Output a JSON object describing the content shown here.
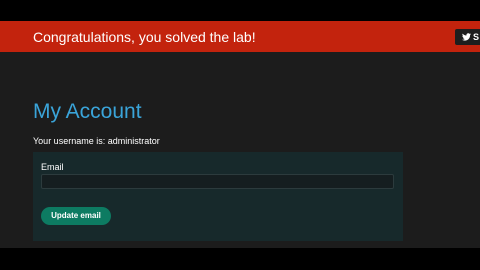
{
  "banner": {
    "message": "Congratulations, you solved the lab!",
    "share_label": "S",
    "share_icon": "twitter-bird-icon"
  },
  "main": {
    "title": "My Account",
    "username_line": "Your username is: administrator"
  },
  "form": {
    "email_label": "Email",
    "email_value": "",
    "submit_label": "Update email"
  },
  "colors": {
    "banner": "#c3230d",
    "title": "#3aa4d9",
    "button": "#0d7b62",
    "panel": "#17292b",
    "background": "#1c1c1c"
  }
}
